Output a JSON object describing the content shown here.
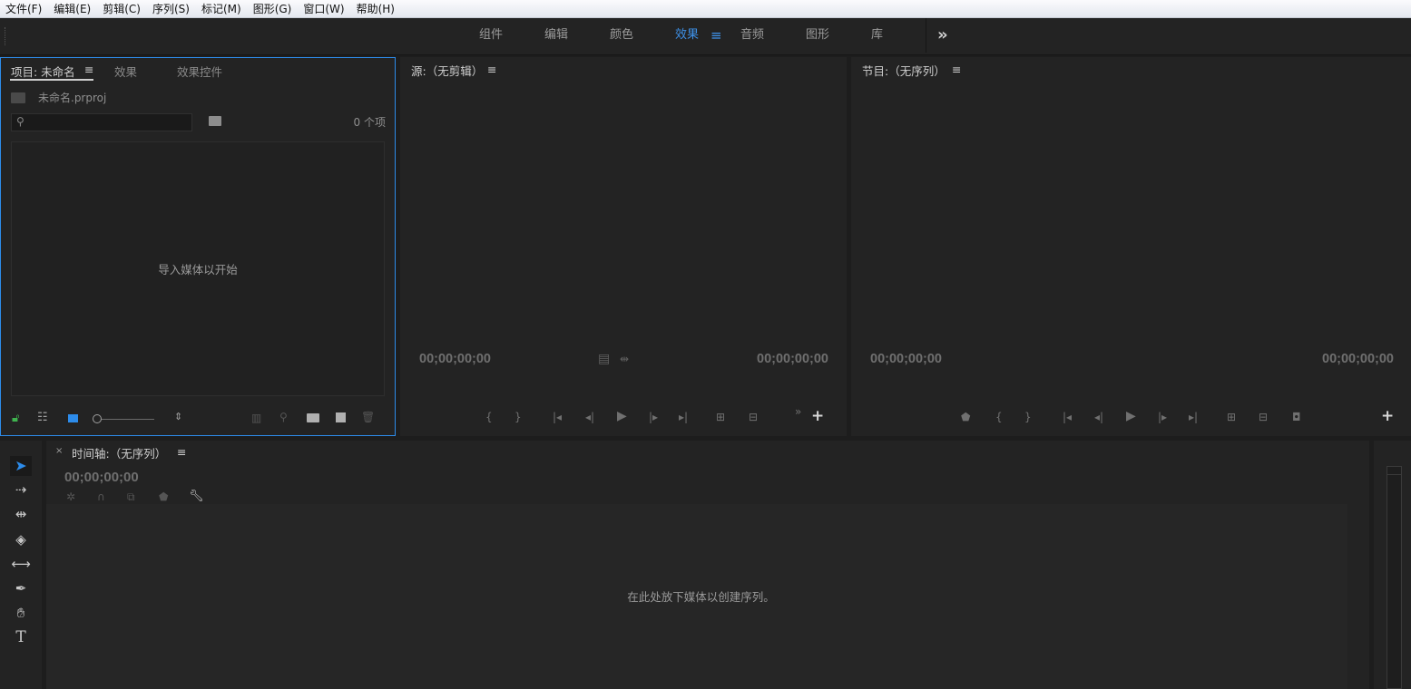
{
  "menu": [
    "文件(F)",
    "编辑(E)",
    "剪辑(C)",
    "序列(S)",
    "标记(M)",
    "图形(G)",
    "窗口(W)",
    "帮助(H)"
  ],
  "workspace": {
    "tabs": [
      "组件",
      "编辑",
      "颜色",
      "效果",
      "音频",
      "图形",
      "库"
    ],
    "active": "效果",
    "menu_icon": "≡",
    "overflow_icon": "»"
  },
  "project": {
    "tabs": [
      "项目: 未命名",
      "效果",
      "效果控件"
    ],
    "file": "未命名.prproj",
    "search_placeholder": "",
    "item_count": "0 个项",
    "empty_message": "导入媒体以开始"
  },
  "source": {
    "title": "源:（无剪辑）",
    "tc_left": "00;00;00;00",
    "tc_right": "00;00;00;00"
  },
  "program": {
    "title": "节目:（无序列）",
    "tc_left": "00;00;00;00",
    "tc_right": "00;00;00;00"
  },
  "timeline": {
    "close": "×",
    "title": "时间轴:（无序列）",
    "timecode": "00;00;00;00",
    "drop_message": "在此处放下媒体以创建序列。"
  },
  "icons": {
    "hamburger": "≡",
    "add": "+",
    "tools": [
      "selection-tool-icon",
      "track-select-icon",
      "ripple-edit-icon",
      "razor-icon",
      "slip-icon",
      "pen-icon",
      "hand-icon",
      "type-icon"
    ]
  }
}
